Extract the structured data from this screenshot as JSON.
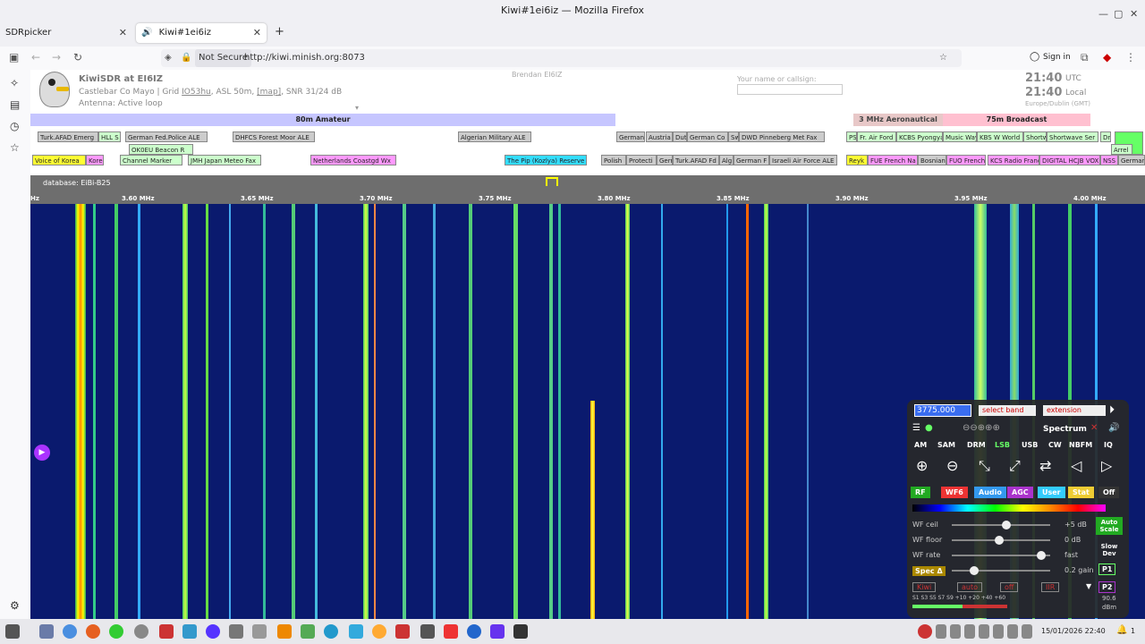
{
  "window": {
    "title": "Kiwi#1ei6iz — Mozilla Firefox"
  },
  "tabs": [
    {
      "label": "SDRpicker"
    },
    {
      "label": "Kiwi#1ei6iz"
    }
  ],
  "nav": {
    "not_secure": "Not Secure",
    "url": "http://kiwi.minish.org:8073",
    "sign_in": "Sign in"
  },
  "header": {
    "title": "KiwiSDR at EI6IZ",
    "location_pre": "Castlebar Co Mayo | Grid ",
    "grid": "IO53hu",
    "location_mid": ", ASL 50m, ",
    "map": "[map]",
    "snr": ", SNR 31/24 dB",
    "antenna": "Antenna: Active loop",
    "owner": "Brendan EI6IZ",
    "name_label": "Your name or callsign:",
    "time_utc": "21:40",
    "utc": "UTC",
    "time_local": "21:40",
    "local": "Local",
    "tz": "Europe/Dublin (GMT)"
  },
  "bands": [
    {
      "label": "80m Amateur"
    },
    {
      "label": "3 MHz Aeronautical"
    },
    {
      "label": "75m Broadcast"
    }
  ],
  "stations_row1": [
    "Turk.AFAD Emerg",
    "HLL S",
    "German Fed.Police ALE",
    "DHFCS Forest Moor ALE",
    "Algerian Military ALE",
    "German",
    "Austria",
    "Dut",
    "German Co",
    "Sw",
    "DWD Pinneberg Met Fax",
    "PS",
    "Fr. Air Ford",
    "KCBS Pyongya",
    "Music Way",
    "KBS W World",
    "Shortw",
    "Shortwave Ser",
    "Dr"
  ],
  "stations_row2": [
    "OK0EU Beacon R",
    "Voice of Korea",
    "Korea",
    "Channel Marker",
    "JMH Japan Meteo Fax",
    "Netherlands Coastgd Wx",
    "The Pip (Kozlya) Reserve",
    "Polish",
    "Protecti",
    "Gerr",
    "Turk.AFAD Fd",
    "Alg",
    "German F",
    "Israeli Air Force ALE",
    "Reyk",
    "FUE French Na",
    "Bosnian",
    "FUO French",
    "KCS Radio France",
    "DIGITAL HCJB VOX",
    "NSS I",
    "German",
    "Arrel"
  ],
  "scale": {
    "database": "database: EiBi-B25",
    "ticks": [
      "3.60 MHz",
      "3.65 MHz",
      "3.70 MHz",
      "3.75 MHz",
      "3.80 MHz",
      "3.85 MHz",
      "3.90 MHz",
      "3.95 MHz",
      "4.00 MHz"
    ],
    "hz": "Hz"
  },
  "control": {
    "freq": "3775.000",
    "select_band": "select band",
    "extension": "extension",
    "spectrum": "Spectrum",
    "modes": [
      "AM",
      "SAM",
      "DRM",
      "LSB",
      "USB",
      "CW",
      "NBFM",
      "IQ"
    ],
    "tabs": [
      "RF",
      "WF6",
      "Audio",
      "AGC",
      "User",
      "Stat",
      "Off"
    ],
    "wf_ceil": "WF ceil",
    "wf_ceil_val": "+5 dB",
    "wf_floor": "WF floor",
    "wf_floor_val": "0 dB",
    "wf_rate": "WF rate",
    "wf_rate_val": "fast",
    "spec": "Spec Δ",
    "gain": "0.2 gain",
    "auto_scale": "Auto Scale",
    "slow_dev": "Slow Dev",
    "p1": "P1",
    "p2": "P2",
    "sel1": "Kiwi",
    "sel2": "auto",
    "sel3": "off",
    "sel4": "IIR",
    "smeter": "S1 S3 S5 S7 S9 +10 +20 +40 +60",
    "db": "dBm",
    "smeter_val": "90.6"
  },
  "taskbar": {
    "clock": "15/01/2026 22:40",
    "badge": "1"
  }
}
